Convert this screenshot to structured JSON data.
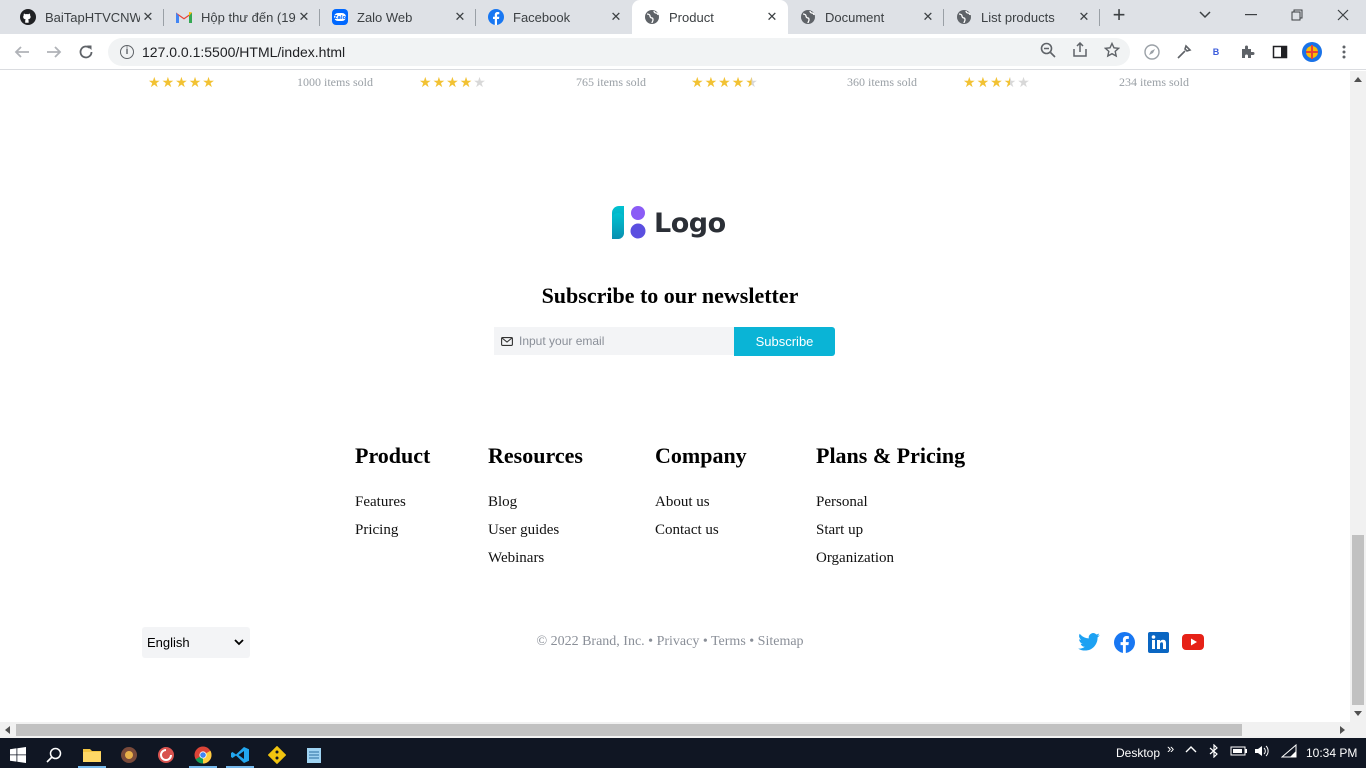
{
  "browser": {
    "tabs": [
      {
        "title": "BaiTapHTVCNWeb",
        "icon": "github-icon",
        "active": false
      },
      {
        "title": "Hộp thư đến (19)",
        "icon": "gmail-icon",
        "active": false
      },
      {
        "title": "Zalo Web",
        "icon": "zalo-icon",
        "active": false
      },
      {
        "title": "Facebook",
        "icon": "facebook-icon",
        "active": false
      },
      {
        "title": "Product",
        "icon": "globe-icon",
        "active": true
      },
      {
        "title": "Document",
        "icon": "globe-icon",
        "active": false
      },
      {
        "title": "List products",
        "icon": "globe-icon",
        "active": false
      }
    ],
    "url": "127.0.0.1:5500/HTML/index.html"
  },
  "products": [
    {
      "rating": 5,
      "sold": "1000 items sold"
    },
    {
      "rating": 4,
      "sold": "765 items sold"
    },
    {
      "rating": 4.5,
      "sold": "360 items sold"
    },
    {
      "rating": 3.5,
      "sold": "234 items sold"
    }
  ],
  "logo": {
    "text": "Logo"
  },
  "newsletter": {
    "title": "Subscribe to our newsletter",
    "placeholder": "Input your email",
    "button": "Subscribe"
  },
  "footer": {
    "columns": [
      {
        "title": "Product",
        "links": [
          "Features",
          "Pricing"
        ]
      },
      {
        "title": "Resources",
        "links": [
          "Blog",
          "User guides",
          "Webinars"
        ]
      },
      {
        "title": "Company",
        "links": [
          "About us",
          "Contact us"
        ]
      },
      {
        "title": "Plans & Pricing",
        "links": [
          "Personal",
          "Start up",
          "Organization"
        ]
      }
    ],
    "language": "English",
    "copyright": "© 2022 Brand, Inc. • Privacy • Terms • Sitemap",
    "social": [
      "twitter-icon",
      "facebook-icon",
      "linkedin-icon",
      "youtube-icon"
    ]
  },
  "taskbar": {
    "desktop_label": "Desktop",
    "time": "10:34 PM"
  },
  "colors": {
    "accent": "#0ab4d6",
    "star": "#f2c233",
    "twitter": "#1da1f2",
    "facebook": "#1877f2",
    "linkedin": "#0a66c2",
    "youtube": "#e62117"
  }
}
